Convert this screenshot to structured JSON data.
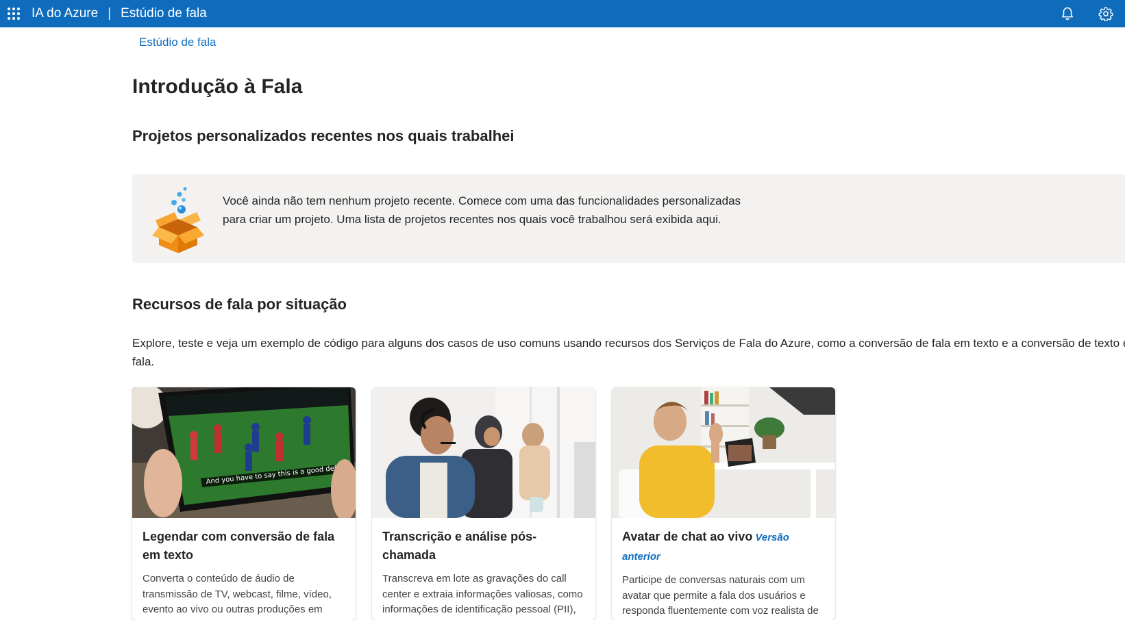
{
  "header": {
    "brand": "IA do Azure",
    "separator": "|",
    "app_name": "Estúdio de fala",
    "accent_color": "#0f6cbd"
  },
  "breadcrumb": {
    "label": "Estúdio de fala"
  },
  "page_title": "Introdução à Fala",
  "recent": {
    "heading": "Projetos personalizados recentes nos quais trabalhei",
    "empty_message": "Você ainda não tem nenhum projeto recente. Comece com uma das funcionalidades personalizadas para criar um projeto. Uma lista de projetos recentes nos quais você trabalhou será exibida aqui."
  },
  "features": {
    "heading": "Recursos de fala por situação",
    "description_line1": "Explore, teste e veja um exemplo de código para alguns dos casos de uso comuns usando recursos dos Serviços de Fala do Azure, como a conversão de fala em texto e a conversão de texto em",
    "description_line2": "fala.",
    "cards": [
      {
        "title": "Legendar com conversão de fala em texto",
        "tag": "",
        "text": "Converta o conteúdo de áudio de transmissão de TV, webcast, filme, vídeo, evento ao vivo ou outras produções em",
        "image_caption": "And you have to say this is a good defense."
      },
      {
        "title": "Transcrição e análise pós-chamada",
        "tag": "",
        "text": "Transcreva em lote as gravações do call center e extraia informações valiosas, como informações de identificação pessoal (PII), sentimento e resumo da chamada."
      },
      {
        "title": "Avatar de chat ao vivo",
        "tag": "Versão anterior",
        "text": "Participe de conversas naturais com um avatar que permite a fala dos usuários e responda fluentemente com voz realista de IA."
      }
    ]
  },
  "icons": {
    "waffle": "app-launcher-icon",
    "bell": "notification-bell-icon",
    "settings": "gear-icon",
    "empty": "open-box-icon"
  }
}
